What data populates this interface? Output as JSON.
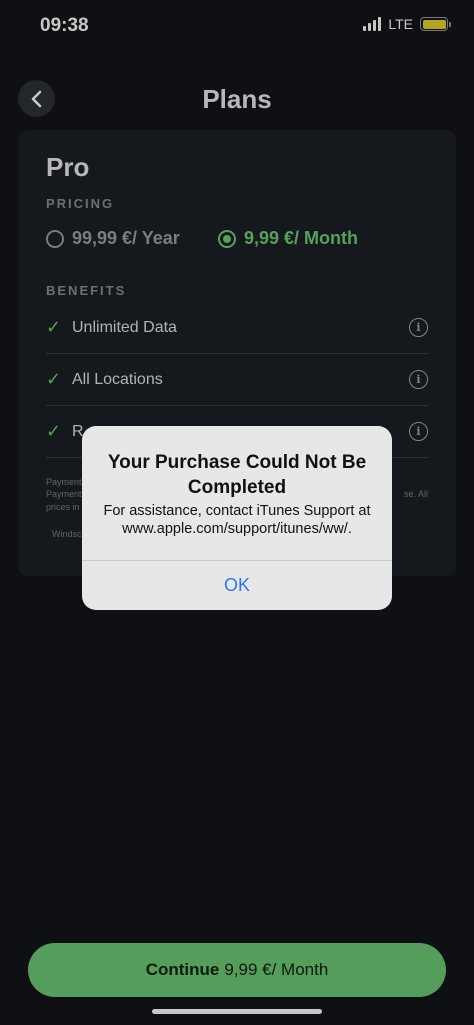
{
  "status_bar": {
    "time": "09:38",
    "network": "LTE"
  },
  "header": {
    "title": "Plans",
    "back_icon": "chevron-left-icon"
  },
  "plan": {
    "name": "Pro",
    "pricing_label": "PRICING",
    "options": [
      {
        "label": "99,99 €/ Year",
        "selected": false
      },
      {
        "label": "9,99 €/ Month",
        "selected": true
      }
    ],
    "benefits_label": "BENEFITS",
    "benefits": [
      {
        "label": "Unlimited Data"
      },
      {
        "label": "All Locations"
      },
      {
        "label": "R"
      }
    ],
    "fineprint": [
      "Payment",
      "Payment",
      "prices in",
      "Windsc",
      "se. All"
    ]
  },
  "continue": {
    "strong": "Continue",
    "price": "9,99 €/ Month"
  },
  "alert": {
    "title": "Your Purchase Could Not Be Completed",
    "message": "For assistance, contact iTunes Support at www.apple.com/support/itunes/ww/.",
    "ok_label": "OK"
  },
  "colors": {
    "accent": "#6ecf76",
    "background": "#121519",
    "card": "#1b1f25",
    "alert_button": "#2f7be4"
  }
}
